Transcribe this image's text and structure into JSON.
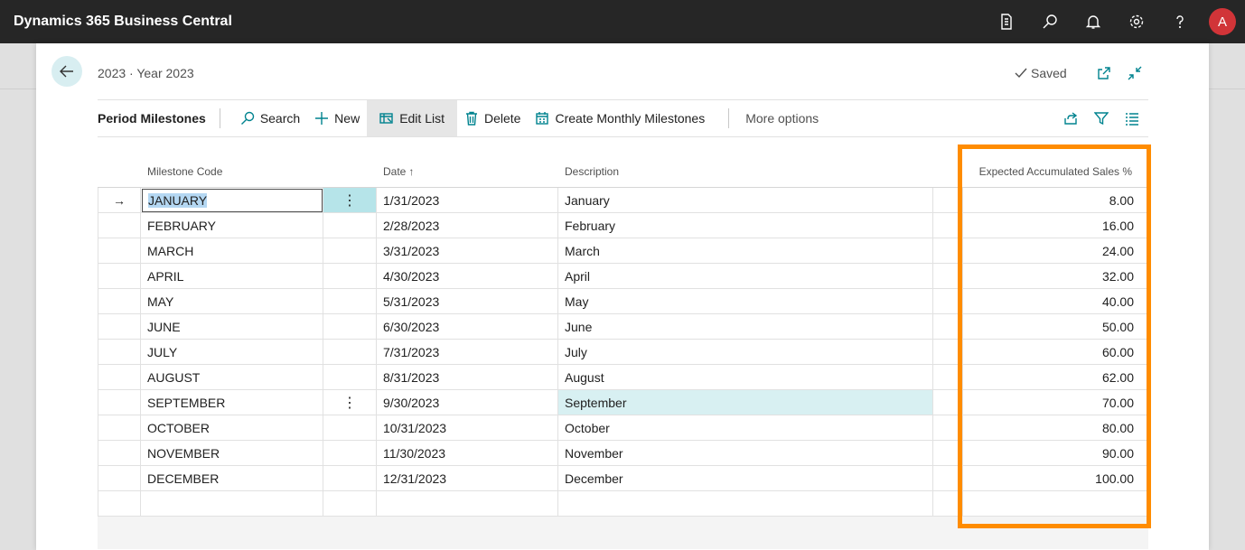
{
  "app": {
    "title": "Dynamics 365 Business Central",
    "avatar_initial": "A"
  },
  "topbar_icons": [
    "document-icon",
    "search-icon",
    "bell-icon",
    "gear-icon",
    "help-icon"
  ],
  "header": {
    "breadcrumb": "2023 · Year 2023",
    "saved_label": "Saved"
  },
  "actions": {
    "page_caption": "Period Milestones",
    "search": "Search",
    "new": "New",
    "edit_list": "Edit List",
    "delete": "Delete",
    "create_monthly": "Create Monthly Milestones",
    "more_options": "More options"
  },
  "columns": {
    "code": "Milestone Code",
    "date": "Date",
    "date_sort": "↑",
    "description": "Description",
    "pct": "Expected Accumulated Sales %"
  },
  "rows": [
    {
      "code": "JANUARY",
      "date": "1/31/2023",
      "description": "January",
      "pct": "8.00"
    },
    {
      "code": "FEBRUARY",
      "date": "2/28/2023",
      "description": "February",
      "pct": "16.00"
    },
    {
      "code": "MARCH",
      "date": "3/31/2023",
      "description": "March",
      "pct": "24.00"
    },
    {
      "code": "APRIL",
      "date": "4/30/2023",
      "description": "April",
      "pct": "32.00"
    },
    {
      "code": "MAY",
      "date": "5/31/2023",
      "description": "May",
      "pct": "40.00"
    },
    {
      "code": "JUNE",
      "date": "6/30/2023",
      "description": "June",
      "pct": "50.00"
    },
    {
      "code": "JULY",
      "date": "7/31/2023",
      "description": "July",
      "pct": "60.00"
    },
    {
      "code": "AUGUST",
      "date": "8/31/2023",
      "description": "August",
      "pct": "62.00"
    },
    {
      "code": "SEPTEMBER",
      "date": "9/30/2023",
      "description": "September",
      "pct": "70.00"
    },
    {
      "code": "OCTOBER",
      "date": "10/31/2023",
      "description": "October",
      "pct": "80.00"
    },
    {
      "code": "NOVEMBER",
      "date": "11/30/2023",
      "description": "November",
      "pct": "90.00"
    },
    {
      "code": "DECEMBER",
      "date": "12/31/2023",
      "description": "December",
      "pct": "100.00"
    }
  ],
  "selected_row_index": 0,
  "hover_row_index": 8,
  "colors": {
    "accent": "#00838f",
    "highlight_box": "#ff8c00",
    "topbar": "#262626",
    "avatar": "#d13438"
  }
}
